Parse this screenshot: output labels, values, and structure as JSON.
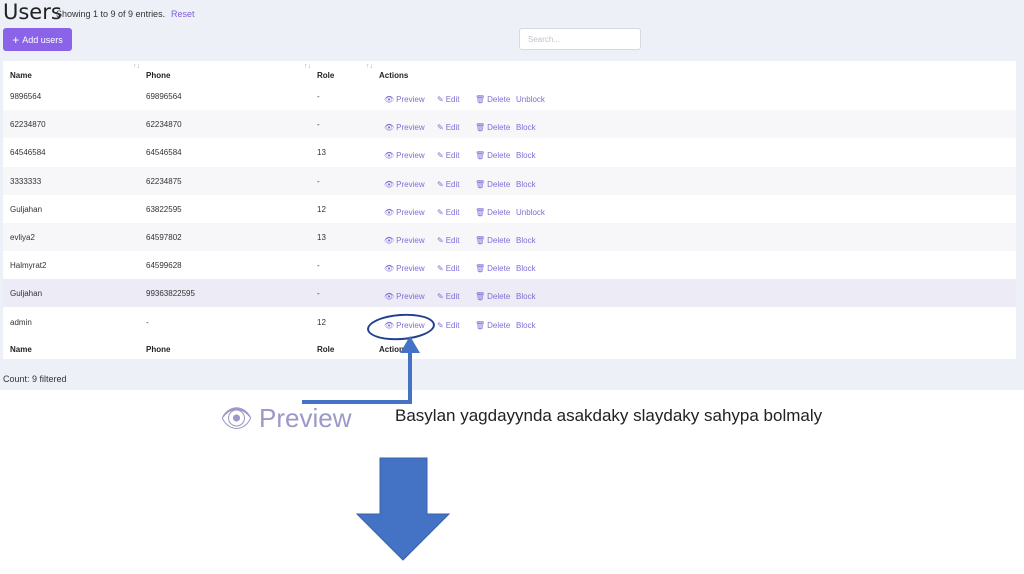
{
  "header": {
    "title": "Users",
    "entries_info": "Showing 1 to 9 of 9 entries.",
    "reset_label": "Reset"
  },
  "toolbar": {
    "add_label": "Add users",
    "search_placeholder": "Search..."
  },
  "table": {
    "columns": [
      "Name",
      "Phone",
      "Role",
      "Actions"
    ],
    "actions": {
      "preview": "Preview",
      "edit": "Edit",
      "delete": "Delete"
    },
    "rows": [
      {
        "name": "9896564",
        "phone": "69896564",
        "role": "-",
        "status_action": "Unblock"
      },
      {
        "name": "62234870",
        "phone": "62234870",
        "role": "-",
        "status_action": "Block"
      },
      {
        "name": "64546584",
        "phone": "64546584",
        "role": "13",
        "status_action": "Block"
      },
      {
        "name": "3333333",
        "phone": "62234875",
        "role": "-",
        "status_action": "Block"
      },
      {
        "name": "Guljahan",
        "phone": "63822595",
        "role": "12",
        "status_action": "Unblock"
      },
      {
        "name": "evliya2",
        "phone": "64597802",
        "role": "13",
        "status_action": "Block"
      },
      {
        "name": "Halmyrat2",
        "phone": "64599628",
        "role": "-",
        "status_action": "Block"
      },
      {
        "name": "Guljahan",
        "phone": "99363822595",
        "role": "-",
        "status_action": "Block"
      },
      {
        "name": "admin",
        "phone": "-",
        "role": "12",
        "status_action": "Block"
      }
    ],
    "footer_columns": [
      "Name",
      "Phone",
      "Role",
      "Actions"
    ]
  },
  "footer": {
    "count_text": "Count: 9 filtered"
  },
  "annotation": {
    "zoom_label": "Preview",
    "caption": "Basylan yagdayynda asakdaky slaydaky sahypa  bolmaly"
  },
  "colors": {
    "accent": "#8a63e8",
    "action_link": "#7c6fd6",
    "annotation_arrow": "#4472c4",
    "annotation_circle": "#1f3f8f"
  },
  "icons": {
    "preview": "eye-icon",
    "edit": "edit-icon",
    "delete": "trash-icon",
    "add": "plus-icon",
    "sort": "sort-icon"
  }
}
